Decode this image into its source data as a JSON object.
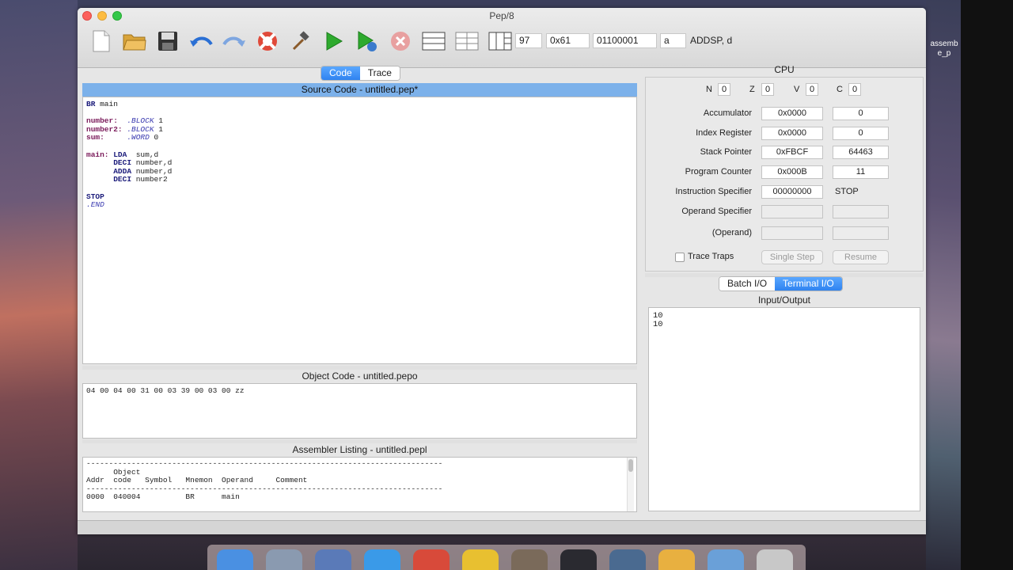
{
  "window": {
    "title": "Pep/8"
  },
  "desktop": {
    "file_label": "assemb\ne_p"
  },
  "toolbar": {
    "icons": [
      "new-file-icon",
      "open-folder-icon",
      "save-disk-icon",
      "undo-icon",
      "redo-icon",
      "help-lifebuoy-icon",
      "assemble-hammer-icon",
      "run-icon",
      "debug-run-icon",
      "stop-icon",
      "layout-single-icon",
      "layout-split-icon",
      "layout-grid-icon"
    ],
    "decimal": "97",
    "hex": "0x61",
    "binary": "01100001",
    "char": "a",
    "mnemonic": "ADDSP, d"
  },
  "left_tabs": {
    "code": "Code",
    "trace": "Trace"
  },
  "source": {
    "title": "Source Code - untitled.pep*",
    "lines": [
      [
        {
          "t": "BR",
          "c": "kw"
        },
        {
          "t": " main",
          "c": ""
        }
      ],
      [
        {
          "t": "",
          "c": ""
        }
      ],
      [
        {
          "t": "number:",
          "c": "lbl"
        },
        {
          "t": "  ",
          "c": ""
        },
        {
          "t": ".BLOCK",
          "c": "dir"
        },
        {
          "t": " 1",
          "c": ""
        }
      ],
      [
        {
          "t": "number2:",
          "c": "lbl"
        },
        {
          "t": " ",
          "c": ""
        },
        {
          "t": ".BLOCK",
          "c": "dir"
        },
        {
          "t": " 1",
          "c": ""
        }
      ],
      [
        {
          "t": "sum:",
          "c": "lbl"
        },
        {
          "t": "     ",
          "c": ""
        },
        {
          "t": ".WORD",
          "c": "dir"
        },
        {
          "t": " 0",
          "c": ""
        }
      ],
      [
        {
          "t": "",
          "c": ""
        }
      ],
      [
        {
          "t": "main:",
          "c": "lbl"
        },
        {
          "t": " ",
          "c": ""
        },
        {
          "t": "LDA",
          "c": "kw"
        },
        {
          "t": "  sum,d",
          "c": ""
        }
      ],
      [
        {
          "t": "      ",
          "c": ""
        },
        {
          "t": "DECI",
          "c": "kw"
        },
        {
          "t": " number,d",
          "c": ""
        }
      ],
      [
        {
          "t": "      ",
          "c": ""
        },
        {
          "t": "ADDA",
          "c": "kw"
        },
        {
          "t": " number,d",
          "c": ""
        }
      ],
      [
        {
          "t": "      ",
          "c": ""
        },
        {
          "t": "DECI",
          "c": "kw"
        },
        {
          "t": " number2",
          "c": ""
        }
      ],
      [
        {
          "t": "",
          "c": ""
        }
      ],
      [
        {
          "t": "STOP",
          "c": "kw"
        }
      ],
      [
        {
          "t": ".END",
          "c": "dir"
        }
      ]
    ]
  },
  "object": {
    "title": "Object Code - untitled.pepo",
    "text": "04 00 04 00 31 00 03 39 00 03 00 zz"
  },
  "listing": {
    "title": "Assembler Listing - untitled.pepl",
    "text": "-------------------------------------------------------------------------------\n      Object\nAddr  code   Symbol   Mnemon  Operand     Comment\n-------------------------------------------------------------------------------\n0000  040004          BR      main"
  },
  "cpu": {
    "title": "CPU",
    "flags": [
      {
        "name": "N",
        "value": "0"
      },
      {
        "name": "Z",
        "value": "0"
      },
      {
        "name": "V",
        "value": "0"
      },
      {
        "name": "C",
        "value": "0"
      }
    ],
    "registers": [
      {
        "label": "Accumulator",
        "hex": "0x0000",
        "dec": "0"
      },
      {
        "label": "Index Register",
        "hex": "0x0000",
        "dec": "0"
      },
      {
        "label": "Stack Pointer",
        "hex": "0xFBCF",
        "dec": "64463"
      },
      {
        "label": "Program Counter",
        "hex": "0x000B",
        "dec": "11"
      },
      {
        "label": "Instruction Specifier",
        "hex": "00000000",
        "dec": "STOP"
      },
      {
        "label": "Operand Specifier",
        "hex": "",
        "dec": ""
      },
      {
        "label": "(Operand)",
        "hex": "",
        "dec": ""
      }
    ],
    "trace_traps": "Trace Traps",
    "single_step": "Single Step",
    "resume": "Resume"
  },
  "io_tabs": {
    "batch": "Batch I/O",
    "terminal": "Terminal I/O"
  },
  "io": {
    "title": "Input/Output",
    "text": "10\n10"
  }
}
